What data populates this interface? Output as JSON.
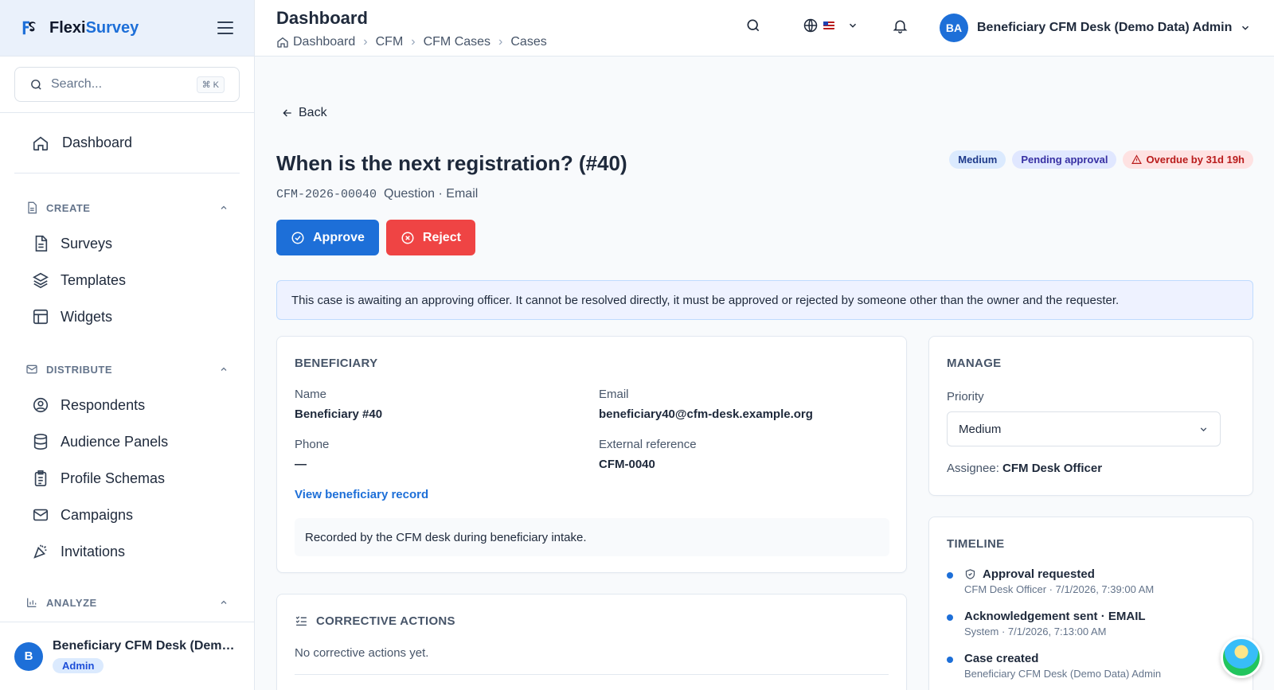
{
  "brand": {
    "name_prefix": "Flexi",
    "name_accent": "Survey"
  },
  "sidebar": {
    "search_placeholder": "Search...",
    "search_shortcut": "⌘ K",
    "dashboard_label": "Dashboard",
    "sections": [
      {
        "title": "CREATE",
        "items": [
          "Surveys",
          "Templates",
          "Widgets"
        ]
      },
      {
        "title": "DISTRIBUTE",
        "items": [
          "Respondents",
          "Audience Panels",
          "Profile Schemas",
          "Campaigns",
          "Invitations"
        ]
      },
      {
        "title": "ANALYZE",
        "items": []
      }
    ],
    "footer_user": {
      "initial": "B",
      "name": "Beneficiary CFM Desk (Demo ...",
      "role": "Admin"
    }
  },
  "header": {
    "title": "Dashboard",
    "breadcrumb": [
      "Dashboard",
      "CFM",
      "CFM Cases",
      "Cases"
    ],
    "user": {
      "initials": "BA",
      "name": "Beneficiary CFM Desk (Demo Data) Admin"
    }
  },
  "case": {
    "back_label": "Back",
    "title": "When is the next registration? (#40)",
    "code": "CFM-2026-00040",
    "meta": "Question · Email",
    "badges": {
      "priority": "Medium",
      "status": "Pending approval",
      "overdue": "Overdue by 31d 19h"
    },
    "approve_label": "Approve",
    "reject_label": "Reject",
    "notice": "This case is awaiting an approving officer. It cannot be resolved directly, it must be approved or rejected by someone other than the owner and the requester."
  },
  "beneficiary": {
    "header": "BENEFICIARY",
    "name_label": "Name",
    "name_value": "Beneficiary #40",
    "email_label": "Email",
    "email_value": "beneficiary40@cfm-desk.example.org",
    "phone_label": "Phone",
    "phone_value": "—",
    "ext_label": "External reference",
    "ext_value": "CFM-0040",
    "link": "View beneficiary record",
    "note": "Recorded by the CFM desk during beneficiary intake."
  },
  "corrective": {
    "header": "CORRECTIVE ACTIONS",
    "empty": "No corrective actions yet."
  },
  "manage": {
    "header": "MANAGE",
    "priority_label": "Priority",
    "priority_value": "Medium",
    "assignee_label": "Assignee:",
    "assignee_value": "CFM Desk Officer"
  },
  "timeline": {
    "header": "TIMELINE",
    "items": [
      {
        "title": "Approval requested",
        "sub": "CFM Desk Officer · 7/1/2026, 7:39:00 AM"
      },
      {
        "title": "Acknowledgement sent · EMAIL",
        "sub": "System · 7/1/2026, 7:13:00 AM"
      },
      {
        "title": "Case created",
        "sub": "Beneficiary CFM Desk (Demo Data) Admin"
      }
    ]
  },
  "colors": {
    "primary": "#1d6fd8",
    "danger": "#ef4444",
    "notice_bg": "#eef2ff"
  }
}
